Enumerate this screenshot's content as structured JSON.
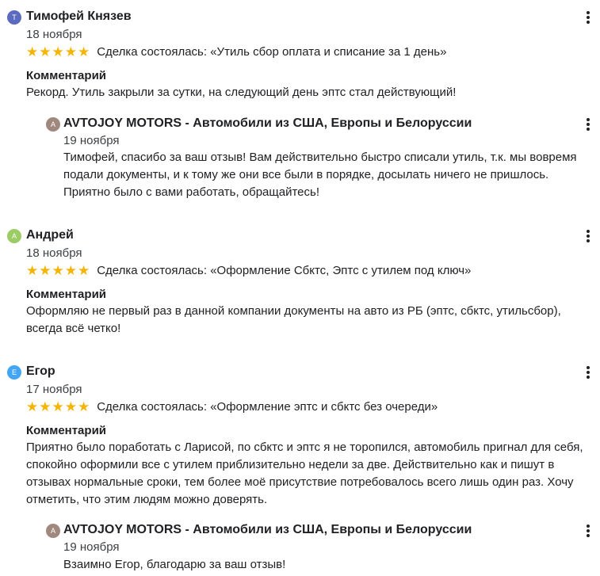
{
  "reviews": [
    {
      "author_initial": "Т",
      "author": "Тимофей Князев",
      "avatar_color": "#5c6bc0",
      "date": "18 ноября",
      "rating": 5,
      "stars": "★★★★★",
      "deal": "Сделка состоялась: «Утиль сбор оплата и списание за 1 день»",
      "comment_title": "Комментарий",
      "comment": "Рекорд. Утиль закрыли за сутки, на следующий день эптс стал действующий!",
      "reply": {
        "author_initial": "A",
        "author": "AVTOJOY MOTORS - Автомобили из США, Европы и Белоруссии",
        "avatar_color": "#a1887f",
        "date": "19 ноября",
        "text": "Тимофей, спасибо за ваш отзыв! Вам действительно быстро списали утиль, т.к. мы вовремя подали документы, и к тому же они все были в порядке, досылать ничего не пришлось. Приятно было с вами работать, обращайтесь!"
      }
    },
    {
      "author_initial": "А",
      "author": "Андрей",
      "avatar_color": "#9ccc65",
      "date": "18 ноября",
      "rating": 5,
      "stars": "★★★★★",
      "deal": "Сделка состоялась: «Оформление Сбктс, Эптс с утилем под ключ»",
      "comment_title": "Комментарий",
      "comment": "Оформляю не первый раз в данной компании документы на авто из РБ (эптс, сбктс, утильсбор), всегда всё четко!"
    },
    {
      "author_initial": "Е",
      "author": "Егор",
      "avatar_color": "#42a5f5",
      "date": "17 ноября",
      "rating": 5,
      "stars": "★★★★★",
      "deal": "Сделка состоялась: «Оформление эптс и сбктс без очереди»",
      "comment_title": "Комментарий",
      "comment": "Приятно было поработать с Ларисой, по сбктс и эптс я не торопился, автомобиль пригнал для себя, спокойно оформили все с утилем приблизительно недели за две. Действительно как и пишут в отзывах нормальные сроки, тем более моё присутствие потребовалось всего лишь один раз. Хочу отметить, что этим людям можно доверять.",
      "reply": {
        "author_initial": "A",
        "author": "AVTOJOY MOTORS - Автомобили из США, Европы и Белоруссии",
        "avatar_color": "#a1887f",
        "date": "19 ноября",
        "text": "Взаимно Егор, благодарю за ваш отзыв!"
      }
    }
  ],
  "icons": {
    "menu": "more-vert-icon",
    "star": "star-icon"
  }
}
